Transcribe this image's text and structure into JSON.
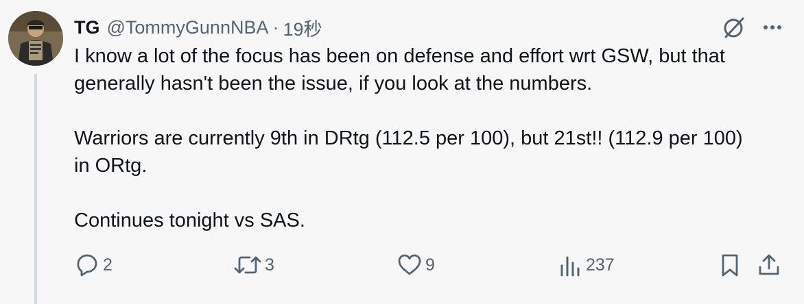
{
  "tweet": {
    "author": {
      "display_name": "TG",
      "handle": "@TommyGunnNBA",
      "separator": "·",
      "time": "19秒"
    },
    "text_lines": [
      "I know a lot of the focus has been on defense and effort wrt GSW, but that",
      "generally hasn't been the issue, if you look at the numbers.",
      "",
      "Warriors are currently 9th in DRtg (112.5 per 100), but 21st!! (112.9 per 100)",
      "in ORtg.",
      "",
      "Continues tonight vs SAS."
    ],
    "actions": {
      "reply_count": "2",
      "retweet_count": "3",
      "like_count": "9",
      "views_count": "237"
    }
  },
  "icons": {
    "avatar": "avatar-photo",
    "grok": "grok-icon",
    "more": "more-icon",
    "reply": "reply-icon",
    "retweet": "retweet-icon",
    "like": "heart-icon",
    "views": "analytics-icon",
    "bookmark": "bookmark-icon",
    "share": "share-icon"
  },
  "colors": {
    "background": "#f7f7f7",
    "text": "#0f1419",
    "secondary": "#536471",
    "thread_line": "#cfd9de"
  }
}
